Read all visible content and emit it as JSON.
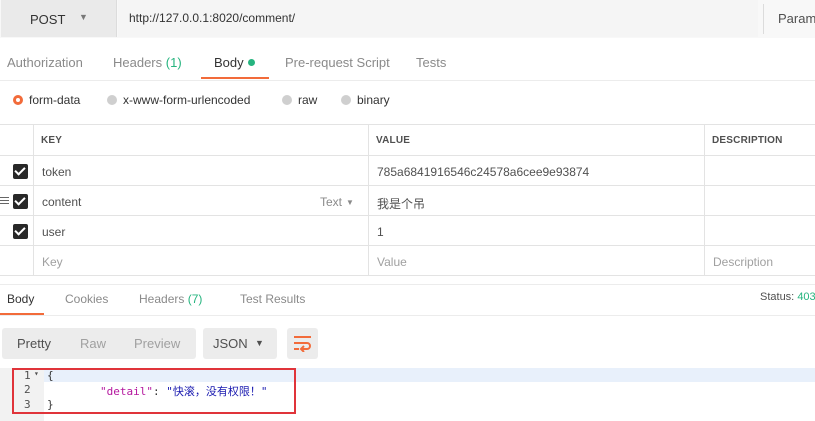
{
  "request": {
    "method": "POST",
    "url": "http://127.0.0.1:8020/comment/",
    "params_label": "Params"
  },
  "req_tabs": {
    "authorization": "Authorization",
    "headers": "Headers",
    "headers_count": "(1)",
    "body": "Body",
    "prerequest": "Pre-request Script",
    "tests": "Tests"
  },
  "body_types": {
    "form_data": "form-data",
    "urlencoded": "x-www-form-urlencoded",
    "raw": "raw",
    "binary": "binary",
    "selected": "form-data"
  },
  "table": {
    "headers": {
      "key": "KEY",
      "value": "VALUE",
      "description": "DESCRIPTION"
    },
    "rows": [
      {
        "key": "token",
        "value": "785a6841916546c24578a6cee9e93874",
        "checked": true
      },
      {
        "key": "content",
        "value": "我是个吊",
        "type": "Text",
        "checked": true
      },
      {
        "key": "user",
        "value": "1",
        "checked": true
      }
    ],
    "placeholder": {
      "key": "Key",
      "value": "Value",
      "description": "Description"
    }
  },
  "resp_tabs": {
    "body": "Body",
    "cookies": "Cookies",
    "headers": "Headers",
    "headers_count": "(7)",
    "test_results": "Test Results"
  },
  "status": {
    "label": "Status:",
    "value": "403"
  },
  "view": {
    "pretty": "Pretty",
    "raw": "Raw",
    "preview": "Preview",
    "format": "JSON"
  },
  "code": {
    "line_numbers": [
      "1",
      "2",
      "3"
    ],
    "open": "{",
    "key": "\"detail\"",
    "colon": ": ",
    "value": "\"快滚，没有权限！\"",
    "close": "}"
  },
  "colors": {
    "accent": "#f26b3a",
    "success": "#26b47f",
    "annotation": "#e0343a"
  }
}
